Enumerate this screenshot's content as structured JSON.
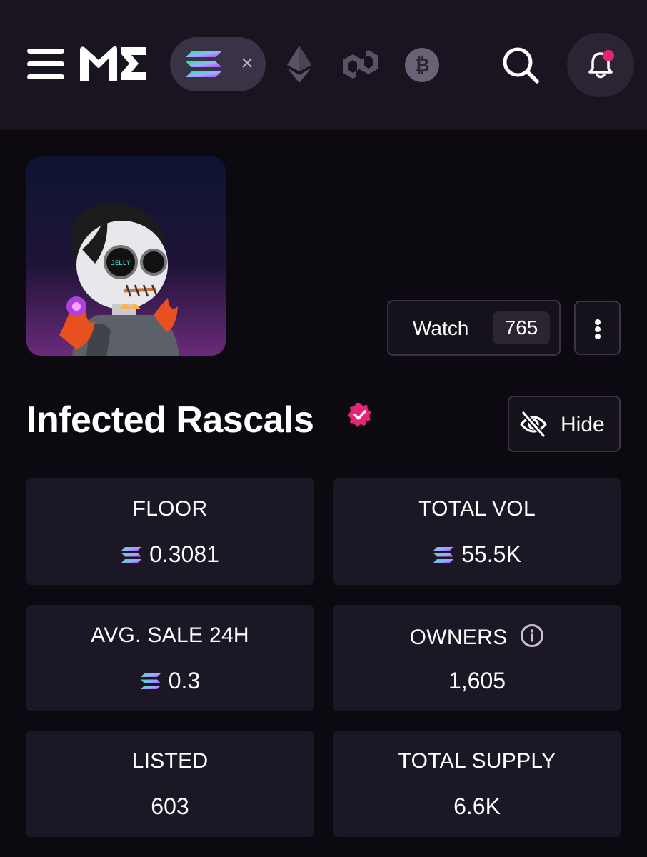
{
  "header": {
    "logo_text": "ME",
    "active_chain": "solana",
    "chains": [
      "solana",
      "ethereum",
      "polygon",
      "bitcoin"
    ],
    "close_glyph": "×",
    "icons": [
      "menu-icon",
      "search-icon",
      "bell-icon"
    ],
    "has_notification": true,
    "btc_glyph": "₿"
  },
  "collection": {
    "name": "Infected Rascals",
    "verified": true,
    "watch_label": "Watch",
    "watch_count": "765",
    "hide_label": "Hide",
    "image_text": "JELLY"
  },
  "stats": [
    {
      "label": "FLOOR",
      "value": "0.3081",
      "currency_icon": true
    },
    {
      "label": "TOTAL VOL",
      "value": "55.5K",
      "currency_icon": true
    },
    {
      "label": "AVG. SALE 24H",
      "value": "0.3",
      "currency_icon": true
    },
    {
      "label": "OWNERS",
      "value": "1,605",
      "currency_icon": false,
      "info_icon": true
    },
    {
      "label": "LISTED",
      "value": "603",
      "currency_icon": false
    },
    {
      "label": "TOTAL SUPPLY",
      "value": "6.6K",
      "currency_icon": false
    }
  ],
  "colors": {
    "background": "#0c0910",
    "topbar": "#1a1421",
    "card": "#1c1724",
    "accent_pink": "#e42575",
    "sol_gradient_start": "#9945ff",
    "sol_gradient_end": "#14f195"
  }
}
